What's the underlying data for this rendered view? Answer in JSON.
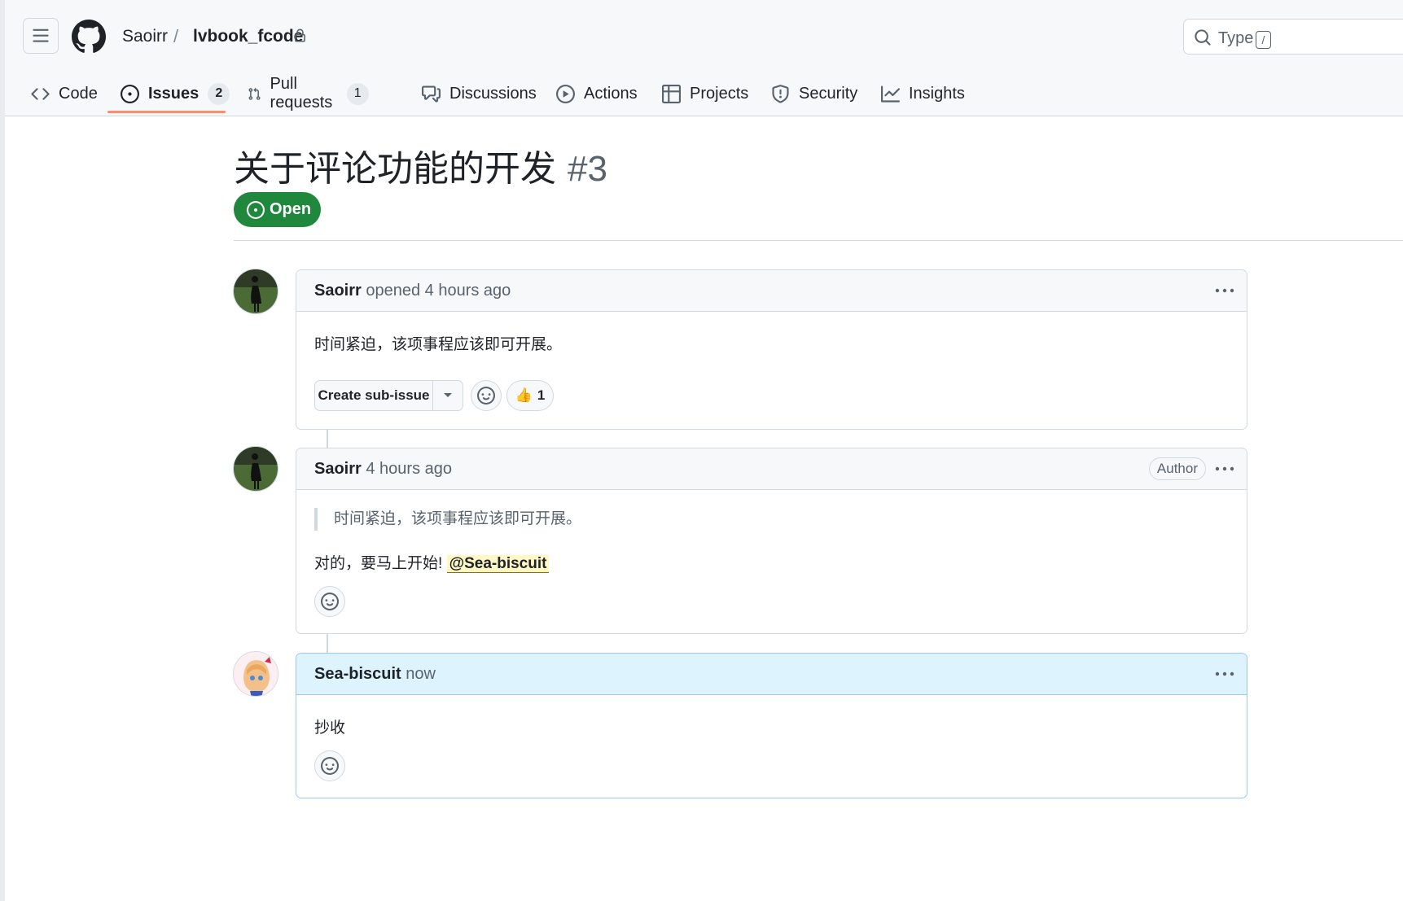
{
  "header": {
    "owner": "Saoirr",
    "separator": "/",
    "repo": "lvbook_fcode",
    "search_placeholder": "Type",
    "search_shortcut": "/"
  },
  "tabs": [
    {
      "label": "Code",
      "icon": "code-icon"
    },
    {
      "label": "Issues",
      "icon": "issue-opened-icon",
      "count": "2",
      "active": true
    },
    {
      "label": "Pull requests",
      "icon": "git-pull-request-icon",
      "count": "1"
    },
    {
      "label": "Discussions",
      "icon": "comment-discussion-icon"
    },
    {
      "label": "Actions",
      "icon": "play-icon"
    },
    {
      "label": "Projects",
      "icon": "table-icon"
    },
    {
      "label": "Security",
      "icon": "shield-icon"
    },
    {
      "label": "Insights",
      "icon": "graph-icon"
    }
  ],
  "issue": {
    "title": "关于评论功能的开发",
    "number": "#3",
    "state": "Open"
  },
  "comments": [
    {
      "author": "Saoirr",
      "meta": "opened 4 hours ago",
      "body": "时间紧迫，该项事程应该即可开展。",
      "create_sub_issue": "Create sub-issue",
      "reaction_count": "1"
    },
    {
      "author": "Saoirr",
      "meta": "4 hours ago",
      "role": "Author",
      "quote": "时间紧迫，该项事程应该即可开展。",
      "body": "对的，要马上开始!",
      "mention": "@Sea-biscuit"
    },
    {
      "author": "Sea-biscuit",
      "meta": "now",
      "body": "抄收"
    }
  ],
  "colors": {
    "open_green": "#1f883d",
    "active_tab_underline": "#fd8c73",
    "highlight_comment_bg": "#ddf4ff",
    "mention_bg": "#fff8c5"
  }
}
